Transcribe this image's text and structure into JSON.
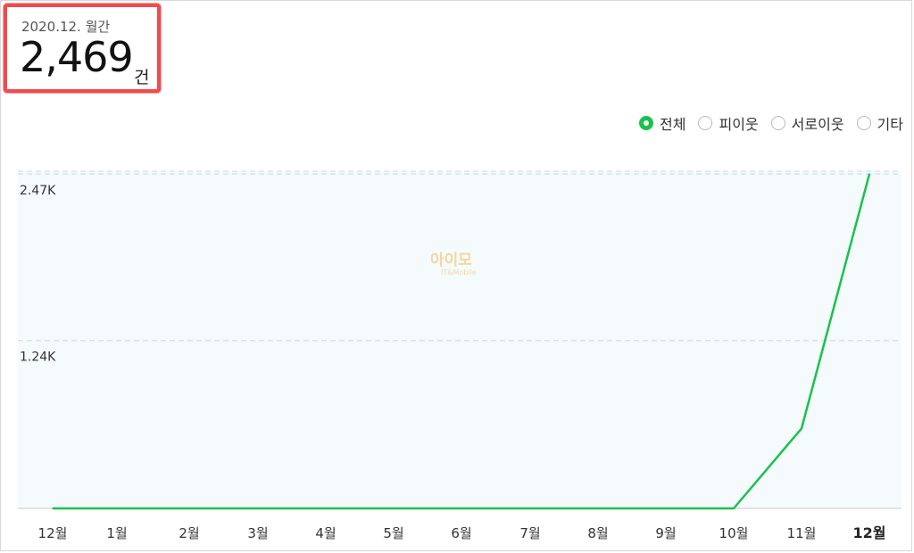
{
  "summary": {
    "period": "2020.12. 월간",
    "count": "2,469",
    "unit": "건"
  },
  "filters": [
    {
      "label": "전체",
      "selected": true
    },
    {
      "label": "피이웃",
      "selected": false
    },
    {
      "label": "서로이웃",
      "selected": false
    },
    {
      "label": "기타",
      "selected": false
    }
  ],
  "watermark": {
    "main": "아이모",
    "sub": "IT&Mobile"
  },
  "colors": {
    "line": "#19c24a",
    "highlight_box": "#f04b50",
    "plot_bg": "#f5fafd"
  },
  "chart_data": {
    "type": "line",
    "categories": [
      "12월",
      "1월",
      "2월",
      "3월",
      "4월",
      "5월",
      "6월",
      "7월",
      "8월",
      "9월",
      "10월",
      "11월",
      "12월"
    ],
    "values": [
      0,
      0,
      0,
      0,
      0,
      0,
      0,
      0,
      0,
      0,
      0,
      590,
      2469
    ],
    "yticks": [
      "2.47K",
      "1.24K"
    ],
    "ytick_values": [
      2470,
      1240
    ],
    "ylim": [
      0,
      2470
    ],
    "highlight_category_index": 12,
    "grid": true
  }
}
